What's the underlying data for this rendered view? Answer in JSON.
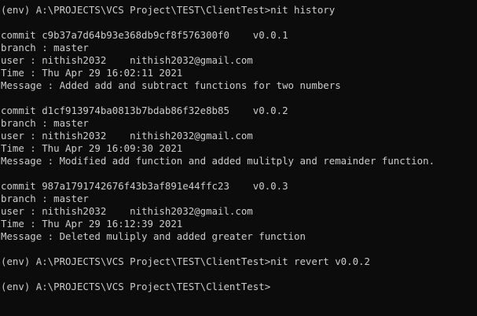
{
  "terminal": {
    "lines": [
      "(env) A:\\PROJECTS\\VCS Project\\TEST\\ClientTest>nit history",
      "",
      "commit c9b37a7d64b93e368db9cf8f576300f0    v0.0.1",
      "branch : master",
      "user : nithish2032    nithish2032@gmail.com",
      "Time : Thu Apr 29 16:02:11 2021",
      "Message : Added add and subtract functions for two numbers",
      "",
      "commit d1cf913974ba0813b7bdab86f32e8b85    v0.0.2",
      "branch : master",
      "user : nithish2032    nithish2032@gmail.com",
      "Time : Thu Apr 29 16:09:30 2021",
      "Message : Modified add function and added mulitply and remainder function.",
      "",
      "commit 987a1791742676f43b3af891e44ffc23    v0.0.3",
      "branch : master",
      "user : nithish2032    nithish2032@gmail.com",
      "Time : Thu Apr 29 16:12:39 2021",
      "Message : Deleted muliply and added greater function",
      "",
      "(env) A:\\PROJECTS\\VCS Project\\TEST\\ClientTest>nit revert v0.0.2",
      "",
      "(env) A:\\PROJECTS\\VCS Project\\TEST\\ClientTest>"
    ]
  },
  "colors": {
    "background": "#0c0c0c",
    "foreground": "#cccccc"
  }
}
